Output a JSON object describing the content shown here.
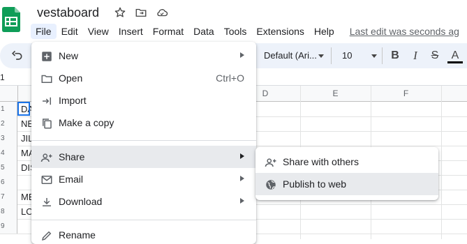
{
  "document": {
    "title": "vestaboard"
  },
  "menubar": {
    "items": [
      "File",
      "Edit",
      "View",
      "Insert",
      "Format",
      "Data",
      "Tools",
      "Extensions",
      "Help"
    ],
    "last_edit": "Last edit was seconds ag"
  },
  "toolbar": {
    "font": "Default (Ari...",
    "font_size": "10",
    "bold": "B",
    "italic": "I",
    "strike": "S",
    "text_color": "A"
  },
  "namebox": {
    "value": "1"
  },
  "grid": {
    "columns": [
      "D",
      "E",
      "F"
    ],
    "rows": [
      "1",
      "2",
      "3",
      "4",
      "5",
      "6",
      "7",
      "8",
      "9"
    ],
    "cells_col_a": [
      "DA",
      "NE",
      "JIL",
      "MA",
      "DIS",
      "",
      "ME",
      "LO",
      ""
    ]
  },
  "file_menu": {
    "items": [
      {
        "label": "New",
        "icon": "plus-box-icon",
        "submenu": true
      },
      {
        "label": "Open",
        "icon": "folder-icon",
        "shortcut": "Ctrl+O"
      },
      {
        "label": "Import",
        "icon": "import-icon"
      },
      {
        "label": "Make a copy",
        "icon": "copy-icon"
      },
      {
        "label": "Share",
        "icon": "person-add-icon",
        "submenu": true,
        "highlighted": true
      },
      {
        "label": "Email",
        "icon": "mail-icon",
        "submenu": true
      },
      {
        "label": "Download",
        "icon": "download-icon",
        "submenu": true
      },
      {
        "label": "Rename",
        "icon": "pencil-icon"
      }
    ]
  },
  "share_menu": {
    "items": [
      {
        "label": "Share with others",
        "icon": "person-add-icon"
      },
      {
        "label": "Publish to web",
        "icon": "globe-icon",
        "highlighted": true
      }
    ]
  },
  "colors": {
    "brand_green": "#0f9d58",
    "selection_blue": "#1a73e8",
    "menu_highlight": "#e8eaed",
    "toolbar_bg": "#edf2fa"
  }
}
